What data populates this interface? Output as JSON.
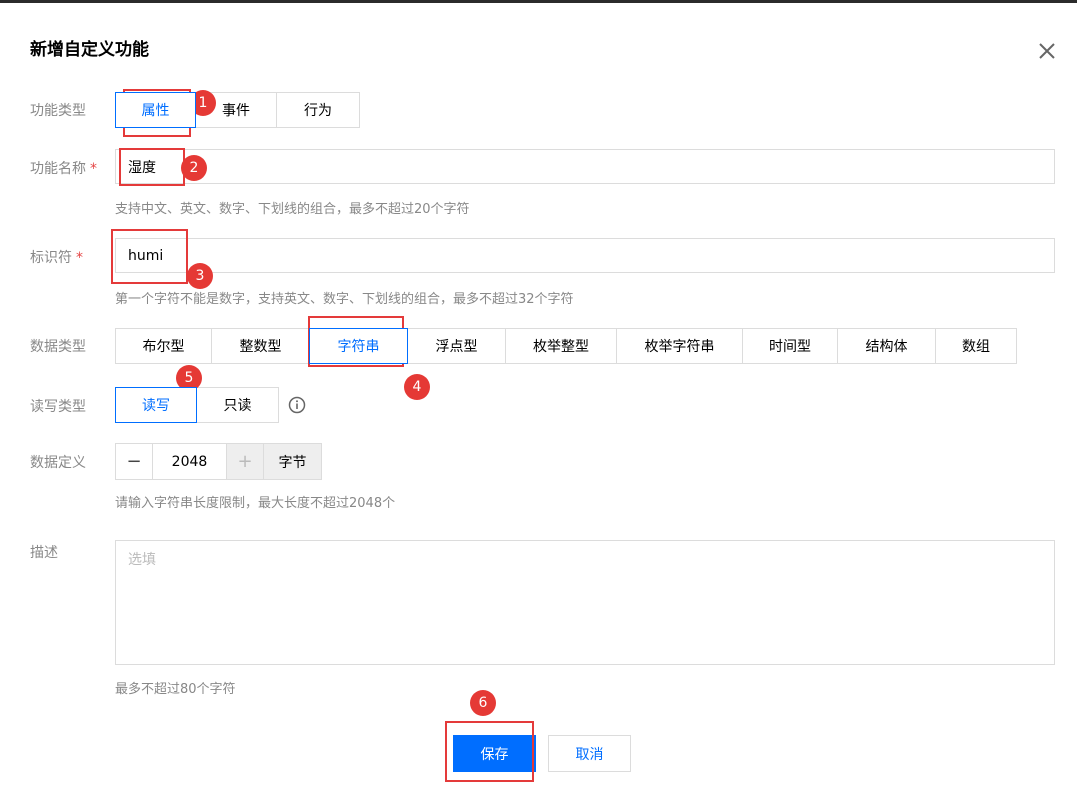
{
  "dialog": {
    "title": "新增自定义功能"
  },
  "fields": {
    "func_type": {
      "label": "功能类型",
      "options": [
        "属性",
        "事件",
        "行为"
      ],
      "selected": "属性"
    },
    "func_name": {
      "label": "功能名称",
      "required_mark": "*",
      "value": "湿度",
      "hint": "支持中文、英文、数字、下划线的组合，最多不超过20个字符"
    },
    "identifier": {
      "label": "标识符",
      "required_mark": "*",
      "value": "humi",
      "hint": "第一个字符不能是数字，支持英文、数字、下划线的组合，最多不超过32个字符"
    },
    "data_type": {
      "label": "数据类型",
      "options": [
        "布尔型",
        "整数型",
        "字符串",
        "浮点型",
        "枚举整型",
        "枚举字符串",
        "时间型",
        "结构体",
        "数组"
      ],
      "selected": "字符串"
    },
    "rw_type": {
      "label": "读写类型",
      "options": [
        "读写",
        "只读"
      ],
      "selected": "读写",
      "info_icon": "info-circle-icon"
    },
    "data_def": {
      "label": "数据定义",
      "minus": "−",
      "value": "2048",
      "plus": "+",
      "unit": "字节",
      "hint": "请输入字符串长度限制，最大长度不超过2048个"
    },
    "description": {
      "label": "描述",
      "placeholder": "选填",
      "hint": "最多不超过80个字符"
    }
  },
  "actions": {
    "save": "保存",
    "cancel": "取消"
  },
  "annotations": [
    "1",
    "2",
    "3",
    "4",
    "5",
    "6"
  ],
  "colors": {
    "accent": "#006eff",
    "annotation": "#e53935"
  }
}
